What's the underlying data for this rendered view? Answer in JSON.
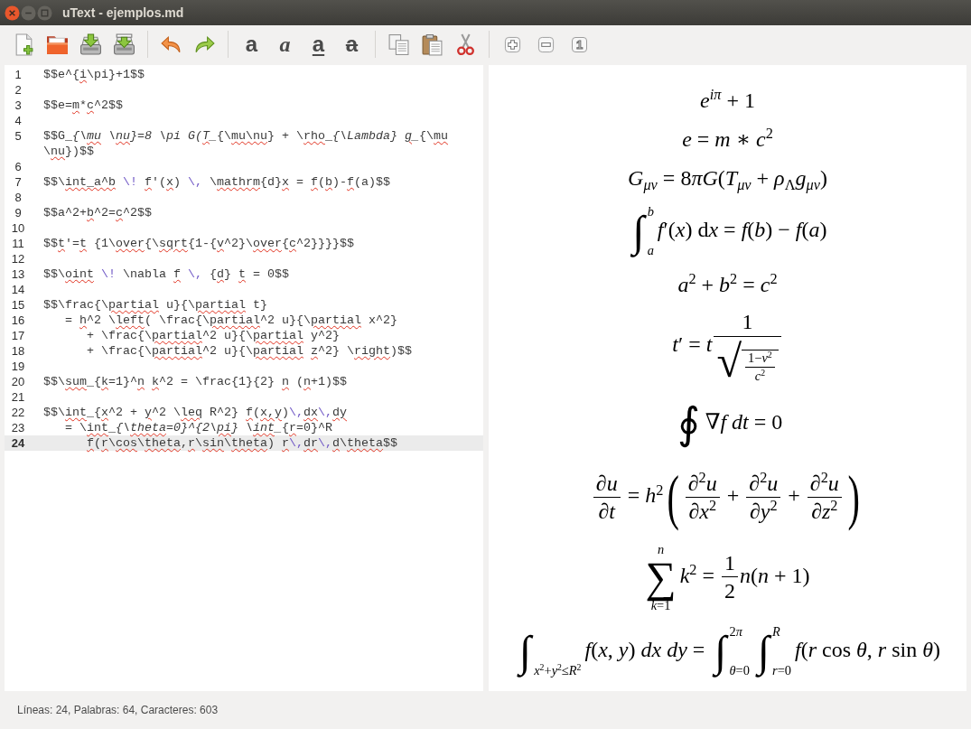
{
  "window": {
    "title": "uText - ejemplos.md"
  },
  "toolbar": {
    "format_buttons": [
      {
        "glyph": "a",
        "kind": "bold"
      },
      {
        "glyph": "a",
        "kind": "italic"
      },
      {
        "glyph": "a",
        "kind": "underline"
      },
      {
        "glyph": "a",
        "kind": "strikethrough"
      }
    ],
    "zoom_reset_label": "1"
  },
  "editor": {
    "lines": [
      {
        "number": "1",
        "current": false,
        "segments": [
          {
            "text": "$$e^{",
            "kind": "plain",
            "misspelled": false
          },
          {
            "text": "i",
            "kind": "plain",
            "misspelled": true
          },
          {
            "text": "\\pi}+1$$",
            "kind": "plain",
            "misspelled": false
          }
        ]
      },
      {
        "number": "2",
        "current": false
      },
      {
        "number": "3",
        "current": false,
        "segments": [
          {
            "text": "$$e=",
            "kind": "plain",
            "misspelled": false
          },
          {
            "text": "m",
            "kind": "plain",
            "misspelled": true
          },
          {
            "text": "*",
            "kind": "plain",
            "misspelled": false
          },
          {
            "text": "c",
            "kind": "plain",
            "misspelled": true
          },
          {
            "text": "^2$$",
            "kind": "plain",
            "misspelled": false
          }
        ]
      },
      {
        "number": "4",
        "current": false
      },
      {
        "number": "5",
        "current": false,
        "segments": [
          {
            "text": "$$G_",
            "kind": "plain",
            "misspelled": false
          },
          {
            "text": "{\\",
            "kind": "italic",
            "misspelled": false
          },
          {
            "text": "mu",
            "kind": "italic",
            "misspelled": true
          },
          {
            "text": " \\",
            "kind": "italic",
            "misspelled": false
          },
          {
            "text": "nu",
            "kind": "italic",
            "misspelled": true
          },
          {
            "text": "}=8 \\pi G(",
            "kind": "italic",
            "misspelled": false
          },
          {
            "text": "T",
            "kind": "italic",
            "misspelled": true
          },
          {
            "text": "_",
            "kind": "italic",
            "misspelled": false
          },
          {
            "text": "{\\",
            "kind": "plain",
            "misspelled": false
          },
          {
            "text": "mu\\nu",
            "kind": "plain",
            "misspelled": true
          },
          {
            "text": "} + \\",
            "kind": "plain",
            "misspelled": false
          },
          {
            "text": "rho",
            "kind": "plain",
            "misspelled": true
          },
          {
            "text": "_",
            "kind": "plain",
            "misspelled": false
          },
          {
            "text": "{\\Lambda} ",
            "kind": "italic",
            "misspelled": false
          },
          {
            "text": "g",
            "kind": "italic",
            "misspelled": true
          },
          {
            "text": "_",
            "kind": "italic",
            "misspelled": false
          },
          {
            "text": "{\\",
            "kind": "plain",
            "misspelled": false
          },
          {
            "text": "mu",
            "kind": "plain",
            "misspelled": true
          },
          {
            "text": " \\",
            "kind": "plain",
            "misspelled": false
          },
          {
            "text": "nu",
            "kind": "plain",
            "misspelled": true
          },
          {
            "text": "})$$",
            "kind": "plain",
            "misspelled": false
          }
        ]
      },
      {
        "number": "6",
        "current": false
      },
      {
        "number": "7",
        "current": false,
        "segments": [
          {
            "text": "$$\\",
            "kind": "plain",
            "misspelled": false
          },
          {
            "text": "int_a^b",
            "kind": "plain",
            "misspelled": true
          },
          {
            "text": " \\! ",
            "kind": "escape",
            "misspelled": false
          },
          {
            "text": "f",
            "kind": "plain",
            "misspelled": true
          },
          {
            "text": "'(",
            "kind": "plain",
            "misspelled": false
          },
          {
            "text": "x",
            "kind": "plain",
            "misspelled": true
          },
          {
            "text": ") ",
            "kind": "plain",
            "misspelled": false
          },
          {
            "text": "\\,",
            "kind": "escape",
            "misspelled": false
          },
          {
            "text": " \\",
            "kind": "plain",
            "misspelled": false
          },
          {
            "text": "mathrm",
            "kind": "plain",
            "misspelled": true
          },
          {
            "text": "{d}",
            "kind": "plain",
            "misspelled": false
          },
          {
            "text": "x",
            "kind": "plain",
            "misspelled": true
          },
          {
            "text": " = ",
            "kind": "plain",
            "misspelled": false
          },
          {
            "text": "f",
            "kind": "plain",
            "misspelled": true
          },
          {
            "text": "(",
            "kind": "plain",
            "misspelled": false
          },
          {
            "text": "b",
            "kind": "plain",
            "misspelled": true
          },
          {
            "text": ")-",
            "kind": "plain",
            "misspelled": false
          },
          {
            "text": "f",
            "kind": "plain",
            "misspelled": true
          },
          {
            "text": "(a)$$",
            "kind": "plain",
            "misspelled": false
          }
        ]
      },
      {
        "number": "8",
        "current": false
      },
      {
        "number": "9",
        "current": false,
        "segments": [
          {
            "text": "$$a^2+",
            "kind": "plain",
            "misspelled": false
          },
          {
            "text": "b",
            "kind": "plain",
            "misspelled": true
          },
          {
            "text": "^2=",
            "kind": "plain",
            "misspelled": false
          },
          {
            "text": "c",
            "kind": "plain",
            "misspelled": true
          },
          {
            "text": "^2$$",
            "kind": "plain",
            "misspelled": false
          }
        ]
      },
      {
        "number": "10",
        "current": false
      },
      {
        "number": "11",
        "current": false,
        "segments": [
          {
            "text": "$$",
            "kind": "plain",
            "misspelled": false
          },
          {
            "text": "t",
            "kind": "plain",
            "misspelled": true
          },
          {
            "text": "'=",
            "kind": "plain",
            "misspelled": false
          },
          {
            "text": "t",
            "kind": "plain",
            "misspelled": true
          },
          {
            "text": " {1\\",
            "kind": "plain",
            "misspelled": false
          },
          {
            "text": "over",
            "kind": "plain",
            "misspelled": true
          },
          {
            "text": "{\\",
            "kind": "plain",
            "misspelled": false
          },
          {
            "text": "sqrt",
            "kind": "plain",
            "misspelled": true
          },
          {
            "text": "{1-{",
            "kind": "plain",
            "misspelled": false
          },
          {
            "text": "v",
            "kind": "plain",
            "misspelled": true
          },
          {
            "text": "^2}\\",
            "kind": "plain",
            "misspelled": false
          },
          {
            "text": "over",
            "kind": "plain",
            "misspelled": true
          },
          {
            "text": "{",
            "kind": "plain",
            "misspelled": false
          },
          {
            "text": "c",
            "kind": "plain",
            "misspelled": true
          },
          {
            "text": "^2}}}}$$",
            "kind": "plain",
            "misspelled": false
          }
        ]
      },
      {
        "number": "12",
        "current": false
      },
      {
        "number": "13",
        "current": false,
        "segments": [
          {
            "text": "$$\\",
            "kind": "plain",
            "misspelled": false
          },
          {
            "text": "oint",
            "kind": "plain",
            "misspelled": true
          },
          {
            "text": " \\!",
            "kind": "escape",
            "misspelled": false
          },
          {
            "text": " \\nabla ",
            "kind": "plain",
            "misspelled": false
          },
          {
            "text": "f",
            "kind": "plain",
            "misspelled": true
          },
          {
            "text": " \\,",
            "kind": "escape",
            "misspelled": false
          },
          {
            "text": " {",
            "kind": "plain",
            "misspelled": false
          },
          {
            "text": "d",
            "kind": "plain",
            "misspelled": true
          },
          {
            "text": "} ",
            "kind": "plain",
            "misspelled": false
          },
          {
            "text": "t",
            "kind": "plain",
            "misspelled": true
          },
          {
            "text": " = 0$$",
            "kind": "plain",
            "misspelled": false
          }
        ]
      },
      {
        "number": "14",
        "current": false
      },
      {
        "number": "15",
        "current": false,
        "segments": [
          {
            "text": "$$\\frac{\\",
            "kind": "plain",
            "misspelled": false
          },
          {
            "text": "partial",
            "kind": "plain",
            "misspelled": true
          },
          {
            "text": " u}{\\",
            "kind": "plain",
            "misspelled": false
          },
          {
            "text": "partial",
            "kind": "plain",
            "misspelled": true
          },
          {
            "text": " t}",
            "kind": "plain",
            "misspelled": false
          }
        ]
      },
      {
        "number": "16",
        "current": false,
        "segments": [
          {
            "text": "   = ",
            "kind": "plain",
            "misspelled": false
          },
          {
            "text": "h",
            "kind": "plain",
            "misspelled": true
          },
          {
            "text": "^2 \\",
            "kind": "plain",
            "misspelled": false
          },
          {
            "text": "left",
            "kind": "plain",
            "misspelled": true
          },
          {
            "text": "( \\frac{\\",
            "kind": "plain",
            "misspelled": false
          },
          {
            "text": "partial",
            "kind": "plain",
            "misspelled": true
          },
          {
            "text": "^2 u}{\\",
            "kind": "plain",
            "misspelled": false
          },
          {
            "text": "partial",
            "kind": "plain",
            "misspelled": true
          },
          {
            "text": " x^2}",
            "kind": "plain",
            "misspelled": false
          }
        ]
      },
      {
        "number": "17",
        "current": false,
        "segments": [
          {
            "text": "      + \\frac{\\",
            "kind": "plain",
            "misspelled": false
          },
          {
            "text": "partial",
            "kind": "plain",
            "misspelled": true
          },
          {
            "text": "^2 u}{\\",
            "kind": "plain",
            "misspelled": false
          },
          {
            "text": "partial",
            "kind": "plain",
            "misspelled": true
          },
          {
            "text": " y^2}",
            "kind": "plain",
            "misspelled": false
          }
        ]
      },
      {
        "number": "18",
        "current": false,
        "segments": [
          {
            "text": "      + \\frac{\\",
            "kind": "plain",
            "misspelled": false
          },
          {
            "text": "partial",
            "kind": "plain",
            "misspelled": true
          },
          {
            "text": "^2 u}{\\",
            "kind": "plain",
            "misspelled": false
          },
          {
            "text": "partial",
            "kind": "plain",
            "misspelled": true
          },
          {
            "text": " z",
            "kind": "plain",
            "misspelled": true
          },
          {
            "text": "^2} \\",
            "kind": "plain",
            "misspelled": false
          },
          {
            "text": "right",
            "kind": "plain",
            "misspelled": true
          },
          {
            "text": ")$$",
            "kind": "plain",
            "misspelled": false
          }
        ]
      },
      {
        "number": "19",
        "current": false
      },
      {
        "number": "20",
        "current": false,
        "segments": [
          {
            "text": "$$\\",
            "kind": "plain",
            "misspelled": false
          },
          {
            "text": "sum",
            "kind": "plain",
            "misspelled": true
          },
          {
            "text": "_{",
            "kind": "plain",
            "misspelled": false
          },
          {
            "text": "k",
            "kind": "plain",
            "misspelled": true
          },
          {
            "text": "=1}^",
            "kind": "plain",
            "misspelled": false
          },
          {
            "text": "n",
            "kind": "plain",
            "misspelled": true
          },
          {
            "text": " k",
            "kind": "plain",
            "misspelled": true
          },
          {
            "text": "^2 = \\frac{1}{2} ",
            "kind": "plain",
            "misspelled": false
          },
          {
            "text": "n",
            "kind": "plain",
            "misspelled": true
          },
          {
            "text": " (",
            "kind": "plain",
            "misspelled": false
          },
          {
            "text": "n",
            "kind": "plain",
            "misspelled": true
          },
          {
            "text": "+1)$$",
            "kind": "plain",
            "misspelled": false
          }
        ]
      },
      {
        "number": "21",
        "current": false
      },
      {
        "number": "22",
        "current": false,
        "segments": [
          {
            "text": "$$\\",
            "kind": "plain",
            "misspelled": false
          },
          {
            "text": "int",
            "kind": "plain",
            "misspelled": true
          },
          {
            "text": "_{",
            "kind": "plain",
            "misspelled": false
          },
          {
            "text": "x",
            "kind": "plain",
            "misspelled": true
          },
          {
            "text": "^2 + ",
            "kind": "plain",
            "misspelled": false
          },
          {
            "text": "y",
            "kind": "plain",
            "misspelled": true
          },
          {
            "text": "^2 \\",
            "kind": "plain",
            "misspelled": false
          },
          {
            "text": "leq",
            "kind": "plain",
            "misspelled": true
          },
          {
            "text": " R^2} ",
            "kind": "plain",
            "misspelled": false
          },
          {
            "text": "f",
            "kind": "plain",
            "misspelled": true
          },
          {
            "text": "(",
            "kind": "plain",
            "misspelled": false
          },
          {
            "text": "x,y",
            "kind": "plain",
            "misspelled": true
          },
          {
            "text": ")",
            "kind": "plain",
            "misspelled": false
          },
          {
            "text": "\\,",
            "kind": "escape",
            "misspelled": false
          },
          {
            "text": "dx",
            "kind": "plain",
            "misspelled": true
          },
          {
            "text": "\\,",
            "kind": "escape",
            "misspelled": false
          },
          {
            "text": "dy",
            "kind": "plain",
            "misspelled": true
          }
        ]
      },
      {
        "number": "23",
        "current": false,
        "segments": [
          {
            "text": "   = \\",
            "kind": "plain",
            "misspelled": false
          },
          {
            "text": "int",
            "kind": "plain",
            "misspelled": true
          },
          {
            "text": "_",
            "kind": "plain",
            "misspelled": false
          },
          {
            "text": "{\\",
            "kind": "italic",
            "misspelled": false
          },
          {
            "text": "theta",
            "kind": "italic",
            "misspelled": true
          },
          {
            "text": "=0}^{2\\",
            "kind": "italic",
            "misspelled": false
          },
          {
            "text": "pi",
            "kind": "italic",
            "misspelled": true
          },
          {
            "text": "} \\",
            "kind": "italic",
            "misspelled": false
          },
          {
            "text": "int",
            "kind": "italic",
            "misspelled": true
          },
          {
            "text": "_",
            "kind": "italic",
            "misspelled": false
          },
          {
            "text": "{",
            "kind": "plain",
            "misspelled": false
          },
          {
            "text": "r",
            "kind": "plain",
            "misspelled": true
          },
          {
            "text": "=0}^R",
            "kind": "plain",
            "misspelled": false
          }
        ]
      },
      {
        "number": "24",
        "current": true,
        "segments": [
          {
            "text": "      f",
            "kind": "plain",
            "misspelled": true
          },
          {
            "text": "(",
            "kind": "plain",
            "misspelled": false
          },
          {
            "text": "r",
            "kind": "plain",
            "misspelled": true
          },
          {
            "text": "\\",
            "kind": "plain",
            "misspelled": false
          },
          {
            "text": "cos",
            "kind": "plain",
            "misspelled": true
          },
          {
            "text": "\\",
            "kind": "plain",
            "misspelled": false
          },
          {
            "text": "theta",
            "kind": "plain",
            "misspelled": true
          },
          {
            "text": ",",
            "kind": "plain",
            "misspelled": false
          },
          {
            "text": "r",
            "kind": "plain",
            "misspelled": true
          },
          {
            "text": "\\",
            "kind": "plain",
            "misspelled": false
          },
          {
            "text": "sin",
            "kind": "plain",
            "misspelled": true
          },
          {
            "text": "\\",
            "kind": "plain",
            "misspelled": false
          },
          {
            "text": "theta",
            "kind": "plain",
            "misspelled": true
          },
          {
            "text": ") ",
            "kind": "plain",
            "misspelled": false
          },
          {
            "text": "r",
            "kind": "plain",
            "misspelled": true
          },
          {
            "text": "\\,",
            "kind": "escape",
            "misspelled": false
          },
          {
            "text": "dr",
            "kind": "plain",
            "misspelled": true
          },
          {
            "text": "\\,",
            "kind": "escape",
            "misspelled": false
          },
          {
            "text": "d",
            "kind": "plain",
            "misspelled": true
          },
          {
            "text": "\\",
            "kind": "plain",
            "misspelled": false
          },
          {
            "text": "theta",
            "kind": "plain",
            "misspelled": true
          },
          {
            "text": "$$",
            "kind": "plain",
            "misspelled": false
          }
        ]
      }
    ]
  },
  "preview": {
    "formulas": [
      {
        "parts": [
          {
            "kind": "text",
            "text": "e"
          },
          {
            "kind": "sup",
            "text": "iπ"
          },
          {
            "kind": "text",
            "text": " + 1"
          }
        ]
      },
      {
        "parts": [
          {
            "kind": "text",
            "text": "e = m ∗ c"
          },
          {
            "kind": "sup",
            "text": "2"
          }
        ]
      },
      {
        "parts": [
          {
            "kind": "text",
            "text": "G"
          },
          {
            "kind": "sub",
            "text": "μν"
          },
          {
            "kind": "text",
            "text": " = 8πG(T"
          },
          {
            "kind": "sub",
            "text": "μν"
          },
          {
            "kind": "text",
            "text": " + ρ"
          },
          {
            "kind": "sub",
            "text": "Λ"
          },
          {
            "kind": "text",
            "text": "g"
          },
          {
            "kind": "sub",
            "text": "μν"
          },
          {
            "kind": "text",
            "text": ")"
          }
        ]
      },
      {
        "parts": [
          {
            "kind": "integral",
            "symbol": "∫",
            "lower": [
              {
                "kind": "text",
                "text": "a"
              }
            ],
            "upper": [
              {
                "kind": "text",
                "text": "b"
              }
            ]
          },
          {
            "kind": "text",
            "text": "f′(x) "
          },
          {
            "kind": "fn",
            "text": "d"
          },
          {
            "kind": "text",
            "text": "x = f(b) − f(a)"
          }
        ]
      },
      {
        "parts": [
          {
            "kind": "text",
            "text": "a"
          },
          {
            "kind": "sup",
            "text": "2"
          },
          {
            "kind": "text",
            "text": " + b"
          },
          {
            "kind": "sup",
            "text": "2"
          },
          {
            "kind": "text",
            "text": " = c"
          },
          {
            "kind": "sup",
            "text": "2"
          }
        ]
      },
      {
        "parts": [
          {
            "kind": "text",
            "text": "t′ = t"
          },
          {
            "kind": "frac",
            "num": [
              {
                "kind": "text",
                "text": "1"
              }
            ],
            "den": [
              {
                "kind": "sqrt",
                "symbol": "√",
                "body": [
                  {
                    "kind": "frac",
                    "num": [
                      {
                        "kind": "text",
                        "text": "1−v"
                      },
                      {
                        "kind": "sup",
                        "text": "2"
                      }
                    ],
                    "den": [
                      {
                        "kind": "text",
                        "text": "c"
                      },
                      {
                        "kind": "sup",
                        "text": "2"
                      }
                    ]
                  }
                ]
              }
            ]
          }
        ]
      },
      {
        "parts": [
          {
            "kind": "integral",
            "symbol": "∮"
          },
          {
            "kind": "text",
            "text": "∇f dt = 0"
          }
        ]
      },
      {
        "parts": [
          {
            "kind": "frac",
            "num": [
              {
                "kind": "text",
                "text": "∂u"
              }
            ],
            "den": [
              {
                "kind": "text",
                "text": "∂t"
              }
            ]
          },
          {
            "kind": "text",
            "text": " = h"
          },
          {
            "kind": "sup",
            "text": "2"
          },
          {
            "kind": "delim",
            "open": "(",
            "close": ")",
            "body": [
              {
                "kind": "frac",
                "num": [
                  {
                    "kind": "text",
                    "text": "∂"
                  },
                  {
                    "kind": "sup",
                    "text": "2"
                  },
                  {
                    "kind": "text",
                    "text": "u"
                  }
                ],
                "den": [
                  {
                    "kind": "text",
                    "text": "∂x"
                  },
                  {
                    "kind": "sup",
                    "text": "2"
                  }
                ]
              },
              {
                "kind": "text",
                "text": " + "
              },
              {
                "kind": "frac",
                "num": [
                  {
                    "kind": "text",
                    "text": "∂"
                  },
                  {
                    "kind": "sup",
                    "text": "2"
                  },
                  {
                    "kind": "text",
                    "text": "u"
                  }
                ],
                "den": [
                  {
                    "kind": "text",
                    "text": "∂y"
                  },
                  {
                    "kind": "sup",
                    "text": "2"
                  }
                ]
              },
              {
                "kind": "text",
                "text": " + "
              },
              {
                "kind": "frac",
                "num": [
                  {
                    "kind": "text",
                    "text": "∂"
                  },
                  {
                    "kind": "sup",
                    "text": "2"
                  },
                  {
                    "kind": "text",
                    "text": "u"
                  }
                ],
                "den": [
                  {
                    "kind": "text",
                    "text": "∂z"
                  },
                  {
                    "kind": "sup",
                    "text": "2"
                  }
                ]
              }
            ]
          }
        ]
      },
      {
        "parts": [
          {
            "kind": "sum",
            "symbol": "∑",
            "lower": [
              {
                "kind": "text",
                "text": "k=1"
              }
            ],
            "upper": [
              {
                "kind": "text",
                "text": "n"
              }
            ]
          },
          {
            "kind": "text",
            "text": "k"
          },
          {
            "kind": "sup",
            "text": "2"
          },
          {
            "kind": "text",
            "text": " = "
          },
          {
            "kind": "frac",
            "num": [
              {
                "kind": "text",
                "text": "1"
              }
            ],
            "den": [
              {
                "kind": "text",
                "text": "2"
              }
            ]
          },
          {
            "kind": "text",
            "text": "n(n + 1)"
          }
        ]
      },
      {
        "parts": [
          {
            "kind": "integral",
            "symbol": "∫",
            "lower": [
              {
                "kind": "text",
                "text": "x"
              },
              {
                "kind": "sup",
                "text": "2"
              },
              {
                "kind": "text",
                "text": "+y"
              },
              {
                "kind": "sup",
                "text": "2"
              },
              {
                "kind": "text",
                "text": "≤R"
              },
              {
                "kind": "sup",
                "text": "2"
              }
            ]
          },
          {
            "kind": "text",
            "text": "f(x, y) dx dy = "
          },
          {
            "kind": "integral",
            "symbol": "∫",
            "lower": [
              {
                "kind": "text",
                "text": "θ=0"
              }
            ],
            "upper": [
              {
                "kind": "text",
                "text": "2π"
              }
            ]
          },
          {
            "kind": "integral",
            "symbol": "∫",
            "lower": [
              {
                "kind": "text",
                "text": "r=0"
              }
            ],
            "upper": [
              {
                "kind": "text",
                "text": "R"
              }
            ]
          },
          {
            "kind": "text",
            "text": "f(r "
          },
          {
            "kind": "fn",
            "text": "cos"
          },
          {
            "kind": "text",
            "text": " θ, r "
          },
          {
            "kind": "fn",
            "text": "sin"
          },
          {
            "kind": "text",
            "text": " θ)"
          }
        ]
      }
    ]
  },
  "status_bar": {
    "text": "Líneas: 24, Palabras: 64, Caracteres: 603"
  }
}
